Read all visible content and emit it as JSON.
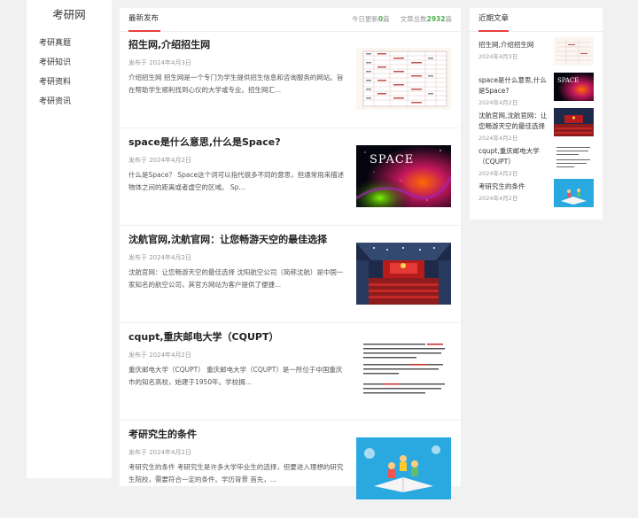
{
  "site": {
    "logo": "考研网"
  },
  "nav": [
    {
      "label": "考研真题"
    },
    {
      "label": "考研知识"
    },
    {
      "label": "考研资料"
    },
    {
      "label": "考研资讯"
    }
  ],
  "main": {
    "title": "最新发布",
    "stats": {
      "today_prefix": "今日更新",
      "today_count": "0",
      "today_suffix": "篇",
      "total_prefix": "文章总数",
      "total_count": "2932",
      "total_suffix": "篇"
    },
    "posts": [
      {
        "title": "招生网,介绍招生网",
        "meta": "发布于 2024年4月3日",
        "excerpt": "介绍招生网 招生网是一个专门为学生提供招生信息和咨询服务的网站。旨在帮助学生顺利找到心仪的大学或专业。招生网汇...",
        "thumb_icon": "table-document-image"
      },
      {
        "title": "space是什么意思,什么是Space?",
        "meta": "发布于 2024年4月2日",
        "excerpt": "什么是Space？ Space这个词可以指代很多不同的意思，但通常用来描述物体之间的距离或者虚空的区域。 Sp...",
        "thumb_icon": "space-image",
        "thumb_text": "SPACE"
      },
      {
        "title": "沈航官网,沈航官网：让您畅游天空的最佳选择",
        "meta": "发布于 2024年4月2日",
        "excerpt": "沈航官网：让您畅游天空的最佳选择 沈阳航空公司（简称沈航）是中国一家知名的航空公司，其官方网站为客户提供了便捷...",
        "thumb_icon": "auditorium-image"
      },
      {
        "title": "cqupt,重庆邮电大学（CQUPT）",
        "meta": "发布于 2024年4月2日",
        "excerpt": "重庆邮电大学（CQUPT） 重庆邮电大学（CQUPT）是一所位于中国重庆市的知名高校，始建于1950年。学校拥...",
        "thumb_icon": "text-document-image"
      },
      {
        "title": "考研究生的条件",
        "meta": "发布于 2024年4月2日",
        "excerpt": "考研究生的条件 考研究生是许多大学毕业生的选择，但要进入理想的研究生院校，需要符合一定的条件。学历背景 首先，...",
        "thumb_icon": "students-illustration-image"
      }
    ]
  },
  "recent": {
    "title": "近期文章",
    "items": [
      {
        "title": "招生网,介绍招生网",
        "date": "2024年4月3日"
      },
      {
        "title": "space是什么意思,什么是Space?",
        "date": "2024年4月2日"
      },
      {
        "title": "沈航官网,沈航官网：让您畅游天空的最佳选择",
        "date": "2024年4月2日"
      },
      {
        "title": "cqupt,重庆邮电大学（CQUPT）",
        "date": "2024年4月2日"
      },
      {
        "title": "考研究生的条件",
        "date": "2024年4月2日"
      }
    ]
  },
  "colors": {
    "accent": "#e94040",
    "count_green": "#4caf50"
  }
}
